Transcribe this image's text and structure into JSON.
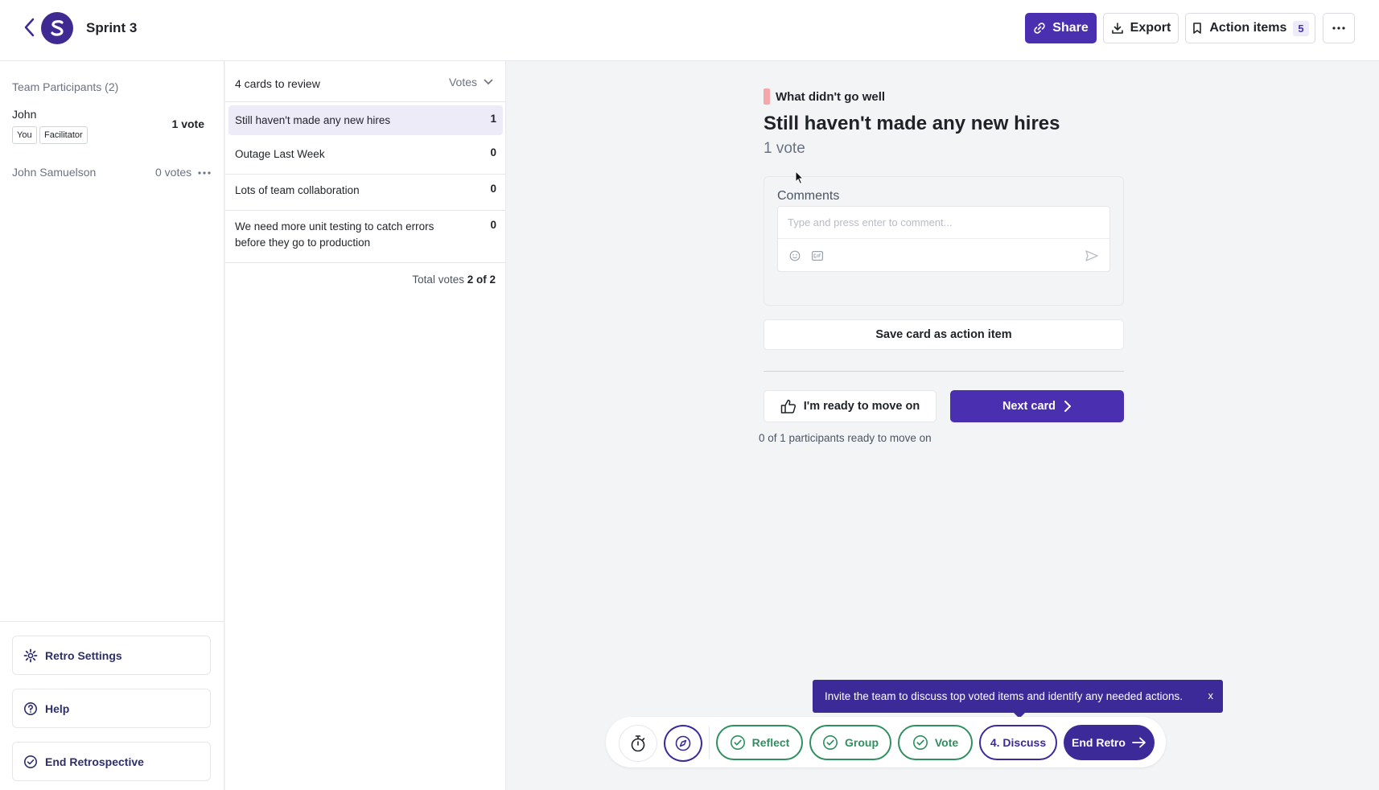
{
  "header": {
    "title": "Sprint 3",
    "share_label": "Share",
    "export_label": "Export",
    "action_items_label": "Action items",
    "action_items_count": "5"
  },
  "participants": {
    "title": "Team Participants (2)",
    "items": [
      {
        "name": "John",
        "tags": [
          "You",
          "Facilitator"
        ],
        "votes": "1 vote"
      },
      {
        "name": "John Samuelson",
        "votes": "0 votes"
      }
    ]
  },
  "sidebar_actions": {
    "settings_label": "Retro Settings",
    "help_label": "Help",
    "end_label": "End Retrospective"
  },
  "cards_panel": {
    "title": "4 cards to review",
    "sort_label": "Votes",
    "cards": [
      {
        "title": "Still haven't made any new hires",
        "votes": "1"
      },
      {
        "title": "Outage Last Week",
        "votes": "0"
      },
      {
        "title": "Lots of team collaboration",
        "votes": "0"
      },
      {
        "title": "We need more unit testing to catch errors before they go to production",
        "votes": "0"
      }
    ],
    "total_label": "Total votes",
    "total_value": "2 of 2"
  },
  "card_detail": {
    "column": "What didn't go well",
    "title": "Still haven't made any new hires",
    "votes": "1 vote",
    "comments_title": "Comments",
    "comment_placeholder": "Type and press enter to comment...",
    "save_action_label": "Save card as action item",
    "ready_label": "I'm ready to move on",
    "next_label": "Next card",
    "ready_status": "0 of 1 participants ready to move on"
  },
  "tooltip": {
    "text": "Invite the team to discuss top voted items and identify any needed actions.",
    "close_label": "x"
  },
  "stages": {
    "reflect": "Reflect",
    "group": "Group",
    "vote": "Vote",
    "discuss": "4. Discuss",
    "end": "End Retro"
  },
  "colors": {
    "primary": "#4a2fb0",
    "stage_done": "#2f8f5f",
    "column_swatch": "#f4a6a8"
  }
}
